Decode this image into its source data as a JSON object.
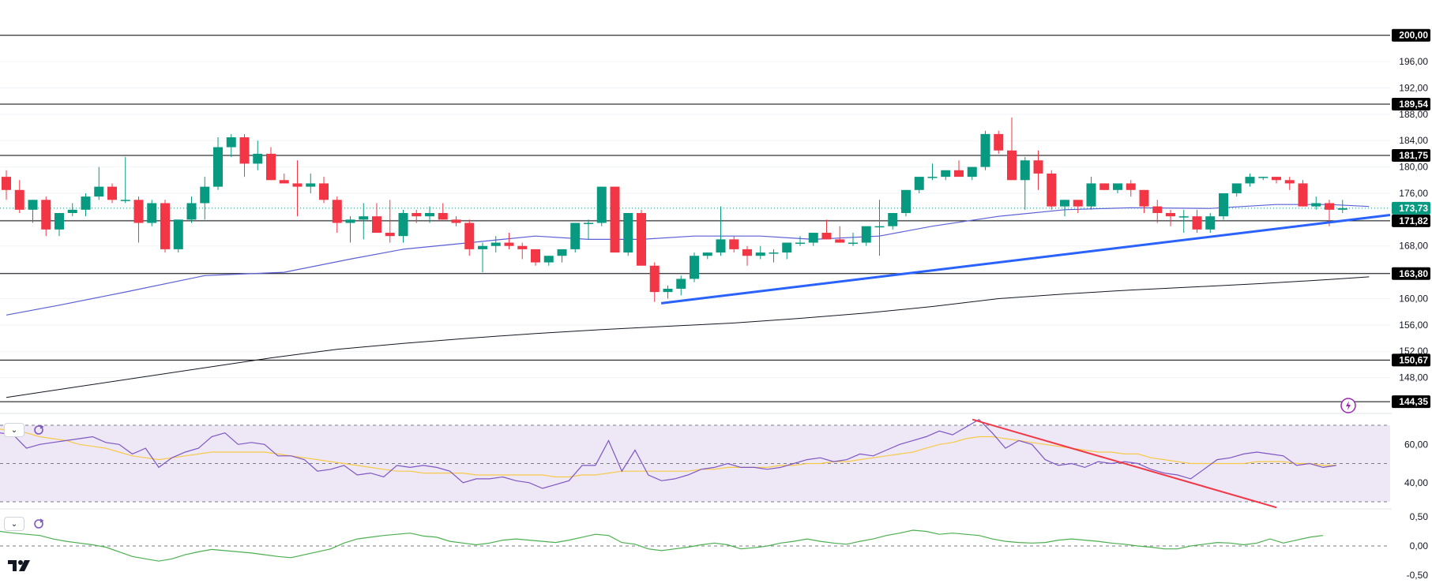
{
  "chart_data": {
    "type": "candlestick",
    "main": {
      "ylim": [
        144,
        202
      ],
      "y_ticks": [
        "200,00",
        "196,00",
        "192,00",
        "188,00",
        "184,00",
        "180,00",
        "176,00",
        "172,00",
        "168,00",
        "164,00",
        "160,00",
        "156,00",
        "152,00",
        "148,00"
      ],
      "y_tick_values": [
        200,
        196,
        192,
        188,
        184,
        180,
        176,
        172,
        168,
        164,
        160,
        156,
        152,
        148
      ],
      "levels": [
        {
          "value": 200.0,
          "label": "200,00"
        },
        {
          "value": 189.54,
          "label": "189,54"
        },
        {
          "value": 181.75,
          "label": "181,75"
        },
        {
          "value": 171.82,
          "label": "171,82"
        },
        {
          "value": 163.8,
          "label": "163,80"
        },
        {
          "value": 150.67,
          "label": "150,67"
        },
        {
          "value": 144.35,
          "label": "144,35"
        }
      ],
      "last_price": {
        "value": 173.73,
        "label": "173,73"
      },
      "candles": [
        [
          178.5,
          179.5,
          175,
          176.5
        ],
        [
          176.5,
          178,
          173,
          173.5
        ],
        [
          173.5,
          175,
          171.5,
          175
        ],
        [
          175,
          175.5,
          169.5,
          170.5
        ],
        [
          170.5,
          173,
          169.5,
          173
        ],
        [
          173,
          174.5,
          172.5,
          173.5
        ],
        [
          173.5,
          176,
          172.5,
          175.5
        ],
        [
          175.5,
          180,
          175,
          177
        ],
        [
          177,
          177.5,
          174.5,
          175
        ],
        [
          175,
          181.5,
          174.5,
          175
        ],
        [
          175,
          175.5,
          168.5,
          171.5
        ],
        [
          171.5,
          175,
          171,
          174.5
        ],
        [
          174.5,
          175,
          167,
          167.5
        ],
        [
          167.5,
          172,
          167,
          172
        ],
        [
          172,
          175.5,
          171.5,
          174.5
        ],
        [
          174.5,
          178.5,
          172,
          177
        ],
        [
          177,
          184.5,
          176.5,
          183
        ],
        [
          183,
          185,
          181.5,
          184.5
        ],
        [
          184.5,
          185,
          178.5,
          180.5
        ],
        [
          180.5,
          184,
          179.5,
          182
        ],
        [
          182,
          183,
          178,
          178
        ],
        [
          178,
          179,
          177.5,
          177.5
        ],
        [
          177.5,
          181,
          172.5,
          177
        ],
        [
          177,
          179,
          176,
          177.5
        ],
        [
          177.5,
          178.5,
          174.5,
          175
        ],
        [
          175,
          175.5,
          170,
          171.5
        ],
        [
          171.5,
          172.5,
          168.5,
          172
        ],
        [
          172,
          174.5,
          169,
          172.5
        ],
        [
          172.5,
          174.5,
          170,
          170
        ],
        [
          170,
          175,
          168.5,
          169.5
        ],
        [
          169.5,
          173.5,
          168.5,
          173
        ],
        [
          173,
          173.5,
          171.5,
          172.5
        ],
        [
          172.5,
          174,
          171.5,
          173
        ],
        [
          173,
          174.5,
          172,
          172
        ],
        [
          172,
          172.5,
          171,
          171.5
        ],
        [
          171.5,
          172,
          166.5,
          167.5
        ],
        [
          167.5,
          168.5,
          164,
          168
        ],
        [
          168,
          169.5,
          167,
          168.5
        ],
        [
          168.5,
          170,
          167.5,
          168
        ],
        [
          168,
          168.5,
          166,
          167.5
        ],
        [
          167.5,
          167.5,
          165,
          165.5
        ],
        [
          165.5,
          166.5,
          165,
          166.5
        ],
        [
          166.5,
          167,
          165.5,
          167.5
        ],
        [
          167.5,
          171.5,
          167,
          171.5
        ],
        [
          171.5,
          172,
          169,
          171.5
        ],
        [
          171.5,
          177,
          171,
          177
        ],
        [
          177,
          177,
          169.5,
          167
        ],
        [
          167,
          173,
          166.5,
          173
        ],
        [
          173,
          173.5,
          165.5,
          165
        ],
        [
          165,
          165.5,
          159.5,
          161
        ],
        [
          161,
          162,
          160,
          161.5
        ],
        [
          161.5,
          163.5,
          160.5,
          163
        ],
        [
          163,
          167,
          162.5,
          166.5
        ],
        [
          166.5,
          167,
          166,
          167
        ],
        [
          167,
          174,
          166.5,
          169
        ],
        [
          169,
          169.5,
          167,
          167.5
        ],
        [
          167.5,
          168,
          165,
          166.5
        ],
        [
          166.5,
          168,
          166,
          167
        ],
        [
          167,
          167.5,
          165.5,
          167
        ],
        [
          167,
          168.5,
          166,
          168.5
        ],
        [
          168.5,
          169.5,
          168,
          168.5
        ],
        [
          168.5,
          170,
          168,
          170
        ],
        [
          170,
          172,
          169,
          169
        ],
        [
          169,
          171,
          168.5,
          168.5
        ],
        [
          168.5,
          170,
          168,
          168.5
        ],
        [
          168.5,
          169.5,
          168,
          171
        ],
        [
          171,
          175,
          166.5,
          171
        ],
        [
          171,
          172,
          170.5,
          173
        ],
        [
          173,
          176.5,
          172.5,
          176.5
        ],
        [
          176.5,
          178.5,
          176,
          178.5
        ],
        [
          178.5,
          180.5,
          178,
          178.5
        ],
        [
          178.5,
          179,
          178,
          179.5
        ],
        [
          179.5,
          181,
          179,
          178.5
        ],
        [
          178.5,
          180,
          178,
          180
        ],
        [
          180,
          185.5,
          179.5,
          185
        ],
        [
          185,
          185.5,
          182,
          182.5
        ],
        [
          182.5,
          187.5,
          182,
          178
        ],
        [
          178,
          181.5,
          173.5,
          181
        ],
        [
          181,
          182.5,
          176.5,
          179
        ],
        [
          179,
          179.5,
          173.5,
          174
        ],
        [
          174,
          175,
          172.5,
          175
        ],
        [
          175,
          175,
          173,
          174
        ],
        [
          174,
          178.5,
          173.5,
          177.5
        ],
        [
          177.5,
          177.5,
          176.5,
          176.5
        ],
        [
          176.5,
          177.5,
          176,
          177.5
        ],
        [
          177.5,
          178,
          175.5,
          176.5
        ],
        [
          176.5,
          176.5,
          173,
          174
        ],
        [
          174,
          175,
          171.5,
          173
        ],
        [
          173,
          173.5,
          171,
          172.5
        ],
        [
          172.5,
          173.5,
          170,
          172.5
        ],
        [
          172.5,
          173.5,
          170,
          170.5
        ],
        [
          170.5,
          173,
          170,
          172.5
        ],
        [
          172.5,
          176,
          172,
          176
        ],
        [
          176,
          177.5,
          175.5,
          177.5
        ],
        [
          177.5,
          179,
          177,
          178.5
        ],
        [
          178.5,
          178.5,
          178,
          178.5
        ],
        [
          178.5,
          178.5,
          177.5,
          178
        ],
        [
          178,
          178.5,
          176.5,
          177.5
        ],
        [
          177.5,
          178,
          174,
          174
        ],
        [
          174,
          175.5,
          173.5,
          174.5
        ],
        [
          174.5,
          175,
          171,
          173.5
        ],
        [
          173.5,
          175,
          173,
          173.73
        ]
      ],
      "ma_short": [
        [
          0,
          157.5
        ],
        [
          4,
          159
        ],
        [
          9,
          161
        ],
        [
          15,
          163.5
        ],
        [
          21,
          164
        ],
        [
          26,
          166
        ],
        [
          30,
          167.5
        ],
        [
          35,
          168.5
        ],
        [
          40,
          169.5
        ],
        [
          44,
          169
        ],
        [
          48,
          169
        ],
        [
          52,
          169.5
        ],
        [
          57,
          169.5
        ],
        [
          61,
          169
        ],
        [
          66,
          169.5
        ],
        [
          70,
          171
        ],
        [
          75,
          172.5
        ],
        [
          80,
          173.5
        ],
        [
          85,
          173.8
        ],
        [
          91,
          173.7
        ],
        [
          96,
          174.3
        ],
        [
          100,
          174.3
        ],
        [
          103,
          174
        ]
      ],
      "ma_long": [
        [
          0,
          145
        ],
        [
          5,
          146.5
        ],
        [
          10,
          148
        ],
        [
          15,
          149.5
        ],
        [
          20,
          151
        ],
        [
          25,
          152.3
        ],
        [
          30,
          153.2
        ],
        [
          35,
          154
        ],
        [
          40,
          154.7
        ],
        [
          45,
          155.3
        ],
        [
          50,
          155.8
        ],
        [
          55,
          156.3
        ],
        [
          60,
          157
        ],
        [
          65,
          157.8
        ],
        [
          70,
          158.8
        ],
        [
          75,
          160
        ],
        [
          80,
          160.7
        ],
        [
          85,
          161.3
        ],
        [
          90,
          161.8
        ],
        [
          95,
          162.3
        ],
        [
          100,
          162.9
        ],
        [
          103,
          163.3
        ]
      ],
      "trendline": [
        [
          49.5,
          159.3
        ],
        [
          106,
          172.7
        ]
      ]
    },
    "rsi": {
      "ylim": [
        30,
        70
      ],
      "y_ticks": [
        "60,00",
        "40,00"
      ],
      "y_tick_values": [
        60,
        40
      ],
      "band": [
        30,
        70
      ],
      "midline": 50,
      "line": [
        66,
        65,
        58,
        60,
        61,
        62,
        63,
        64,
        61,
        60,
        55,
        58,
        48,
        53,
        56,
        58,
        64,
        66,
        60,
        61,
        60,
        54,
        54,
        52,
        46,
        47,
        49,
        44,
        45,
        43,
        49,
        48,
        49,
        48,
        46,
        40,
        42,
        42,
        43,
        41,
        40,
        37,
        39,
        41,
        49,
        49,
        62,
        46,
        57,
        44,
        41,
        42,
        44,
        47,
        48,
        50,
        48,
        48,
        47,
        48,
        50,
        52,
        53,
        51,
        52,
        55,
        54,
        57,
        60,
        62,
        64,
        67,
        65,
        69,
        73,
        66,
        58,
        62,
        60,
        52,
        49,
        50,
        48,
        51,
        50,
        51,
        50,
        47,
        45,
        44,
        42,
        47,
        52,
        53,
        55,
        56,
        55,
        54,
        49,
        50,
        48,
        49
      ],
      "signal": [
        68,
        67,
        66,
        64,
        63,
        62,
        60,
        59,
        58,
        56,
        54,
        53,
        52,
        53,
        54,
        55,
        56,
        56,
        56,
        56,
        56,
        55,
        54,
        53,
        52,
        51,
        50,
        49,
        48,
        47,
        46,
        46,
        45,
        45,
        45,
        45,
        44,
        44,
        44,
        44,
        44,
        44,
        43,
        43,
        44,
        44,
        45,
        46,
        46,
        46,
        46,
        46,
        46,
        47,
        47,
        48,
        48,
        48,
        48,
        49,
        49,
        50,
        50,
        51,
        51,
        52,
        53,
        54,
        55,
        56,
        58,
        60,
        61,
        63,
        64,
        64,
        63,
        62,
        61,
        60,
        59,
        58,
        57,
        56,
        56,
        55,
        55,
        53,
        52,
        51,
        50,
        50,
        50,
        50,
        50,
        51,
        51,
        51,
        50,
        50,
        49,
        49
      ],
      "trendline": [
        [
          73.5,
          73
        ],
        [
          96.5,
          27
        ]
      ]
    },
    "osc": {
      "ylim": [
        -0.5,
        0.5
      ],
      "y_ticks": [
        "0,50",
        "0,00",
        "-0,50"
      ],
      "y_tick_values": [
        0.5,
        0,
        -0.5
      ],
      "zero": 0,
      "line": [
        0.25,
        0.22,
        0.2,
        0.18,
        0.12,
        0.08,
        0.05,
        0.02,
        -0.02,
        -0.1,
        -0.18,
        -0.22,
        -0.26,
        -0.22,
        -0.15,
        -0.1,
        -0.06,
        -0.08,
        -0.1,
        -0.12,
        -0.15,
        -0.18,
        -0.2,
        -0.15,
        -0.1,
        -0.05,
        0.05,
        0.12,
        0.15,
        0.18,
        0.2,
        0.22,
        0.17,
        0.15,
        0.08,
        0.05,
        0.02,
        0.05,
        0.1,
        0.12,
        0.1,
        0.08,
        0.06,
        0.1,
        0.15,
        0.2,
        0.18,
        0.06,
        0.03,
        -0.05,
        -0.08,
        -0.05,
        -0.02,
        0.02,
        0.05,
        0.02,
        -0.05,
        -0.03,
        0.0,
        0.05,
        0.08,
        0.12,
        0.08,
        0.05,
        0.03,
        0.08,
        0.12,
        0.18,
        0.22,
        0.27,
        0.25,
        0.2,
        0.22,
        0.2,
        0.18,
        0.12,
        0.08,
        0.06,
        0.05,
        0.06,
        0.1,
        0.12,
        0.1,
        0.08,
        0.05,
        0.03,
        0.0,
        -0.02,
        -0.05,
        -0.05,
        0.0,
        0.03,
        0.06,
        0.05,
        0.02,
        0.05,
        0.12,
        0.05,
        0.1,
        0.15,
        0.18
      ]
    },
    "colors": {
      "up": "#089981",
      "down": "#f23645",
      "ma_short": "#5b5fd6",
      "ma_long": "#131722",
      "trendline_main": "#2962ff",
      "rsi_line": "#7e57c2",
      "rsi_signal": "#f7c948",
      "rsi_band": "#ede7f6",
      "rsi_trend": "#f23645",
      "osc_line": "#4caf50",
      "last_price_tag": "#089981",
      "level_tag": "#000000"
    }
  },
  "ui": {
    "collapse_icon": "chevron-down-icon",
    "sync_icon": "sync-icon",
    "alert_icon": "lightning-icon",
    "logo": "TV"
  }
}
